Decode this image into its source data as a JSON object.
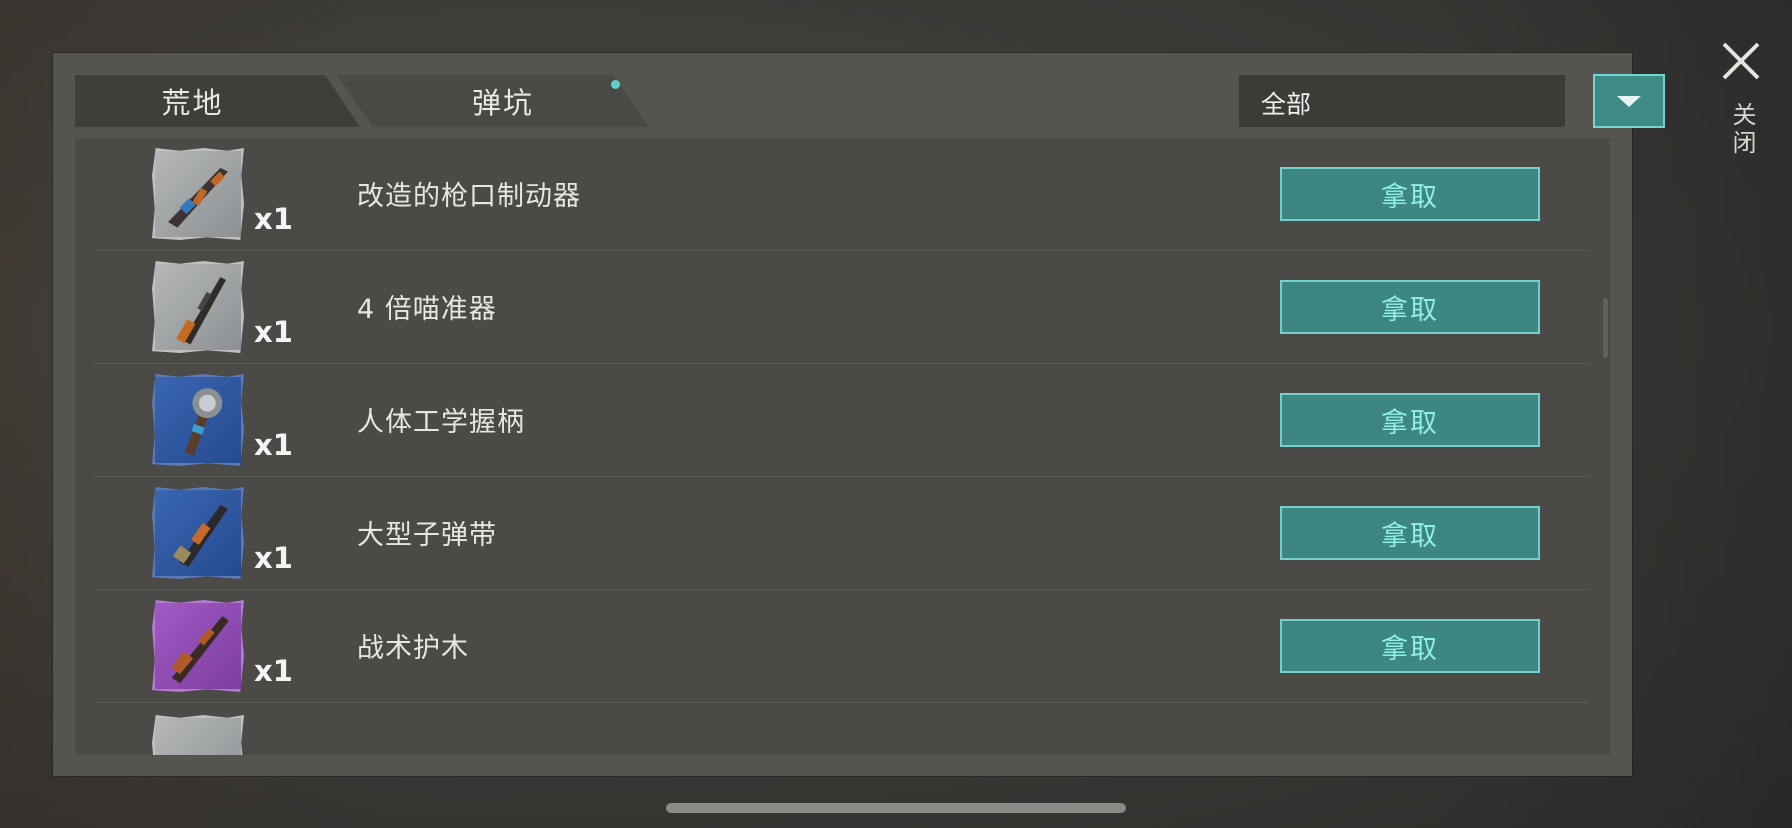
{
  "tabs": [
    {
      "label": "荒地",
      "active": true
    },
    {
      "label": "弹坑",
      "active": false,
      "has_notification": true
    }
  ],
  "filter": {
    "label": "全部"
  },
  "close": {
    "label": "关闭"
  },
  "items": [
    {
      "count": "x1",
      "name": "",
      "rarity": "gray",
      "icon": "rifle-icon"
    },
    {
      "count": "x1",
      "name": "改造的枪口制动器",
      "rarity": "gray",
      "icon": "assault-rifle-icon",
      "button": "拿取"
    },
    {
      "count": "x1",
      "name": "4 倍喵准器",
      "rarity": "gray",
      "icon": "sniper-rifle-icon",
      "button": "拿取"
    },
    {
      "count": "x1",
      "name": "人体工学握柄",
      "rarity": "blue",
      "icon": "spiked-club-icon",
      "button": "拿取"
    },
    {
      "count": "x1",
      "name": "大型子弹带",
      "rarity": "blue",
      "icon": "shotgun-icon",
      "button": "拿取"
    },
    {
      "count": "x1",
      "name": "战术护木",
      "rarity": "purple",
      "icon": "hunting-rifle-icon",
      "button": "拿取"
    }
  ]
}
